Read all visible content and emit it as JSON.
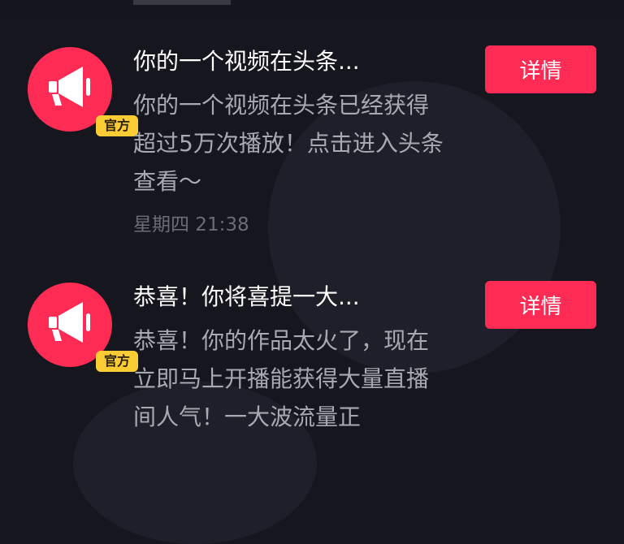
{
  "colors": {
    "background": "#16161f",
    "accent": "#fe2c55",
    "badge": "#fccc35"
  },
  "messages": [
    {
      "avatar_icon": "megaphone-icon",
      "badge": "官方",
      "title": "你的一个视频在头条...",
      "body": "你的一个视频在头条已经获得超过5万次播放！点击进入头条查看～",
      "time": "星期四 21:38",
      "button_label": "详情"
    },
    {
      "avatar_icon": "megaphone-icon",
      "badge": "官方",
      "title": "恭喜！你将喜提一大...",
      "body": "恭喜！你的作品太火了，现在立即马上开播能获得大量直播间人气！一大波流量正",
      "button_label": "详情"
    }
  ]
}
